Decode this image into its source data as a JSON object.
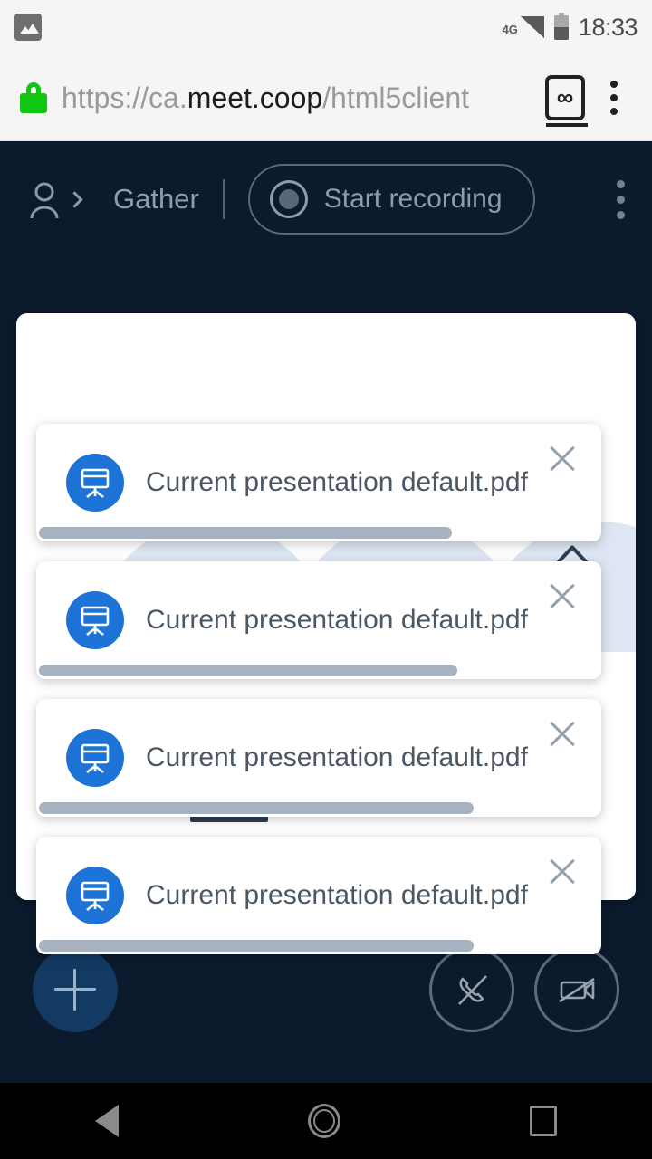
{
  "status_bar": {
    "notification_icon": "image-icon",
    "network_type": "4G",
    "signal_icon": "signal-bars-icon",
    "battery_icon": "battery-icon",
    "clock": "18:33"
  },
  "browser": {
    "lock_icon": "lock-icon",
    "url_scheme": "https://ca.",
    "url_host": "meet.coop",
    "url_path": "/html5client",
    "tab_count_label": "∞",
    "menu_icon": "kebab-menu-icon"
  },
  "app_header": {
    "user_list_icon": "user-icon",
    "meeting_title": "Gather",
    "recording_button_label": "Start recording",
    "recording_icon": "record-dot-icon",
    "options_icon": "kebab-menu-icon"
  },
  "presentation": {
    "prev_slide_icon": "chevron-up-icon",
    "next_slide_icon": "chevron-down-icon"
  },
  "toasts": [
    {
      "icon": "presentation-icon",
      "message": "Current presentation default.pdf",
      "close_icon": "close-icon",
      "progress_percent": 73
    },
    {
      "icon": "presentation-icon",
      "message": "Current presentation default.pdf",
      "close_icon": "close-icon",
      "progress_percent": 74
    },
    {
      "icon": "presentation-icon",
      "message": "Current presentation default.pdf",
      "close_icon": "close-icon",
      "progress_percent": 77
    },
    {
      "icon": "presentation-icon",
      "message": "Current presentation default.pdf",
      "close_icon": "close-icon",
      "progress_percent": 77
    }
  ],
  "action_bar": {
    "add_icon": "plus-icon",
    "audio_icon": "phone-off-icon",
    "video_icon": "camera-off-icon"
  },
  "nav_bar": {
    "back_icon": "back-triangle-icon",
    "home_icon": "home-circle-icon",
    "recents_icon": "recents-square-icon"
  },
  "colors": {
    "app_background": "#0b1b2d",
    "accent_blue": "#1d74d6",
    "lock_green": "#11c611",
    "toast_text": "#4a5866",
    "progress_bar": "#a6b2bf"
  }
}
